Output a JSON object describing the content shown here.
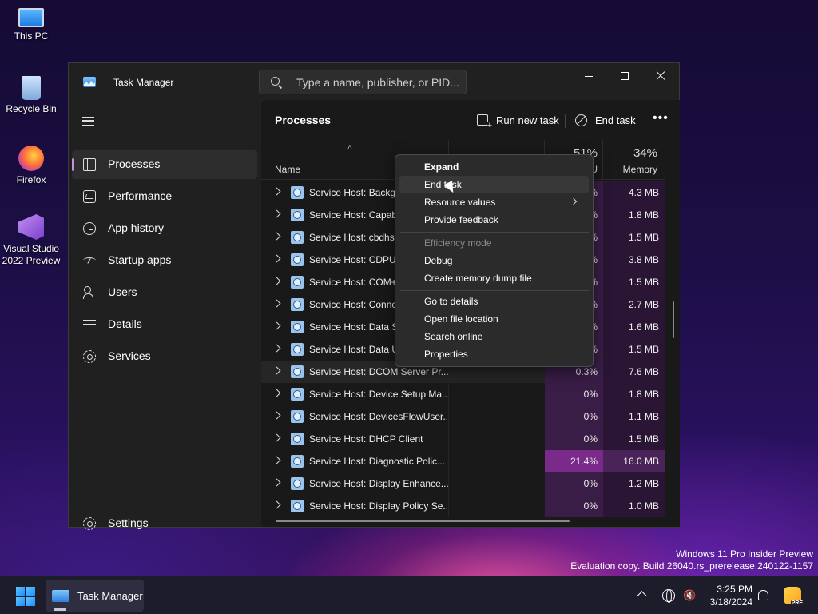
{
  "desktop": {
    "icons": [
      {
        "label": "This PC"
      },
      {
        "label": "Recycle Bin"
      },
      {
        "label": "Firefox"
      },
      {
        "label": "Visual Studio 2022 Preview"
      }
    ],
    "watermark": {
      "line1": "Windows 11 Pro Insider Preview",
      "line2": "Evaluation copy. Build 26040.rs_prerelease.240122-1157"
    }
  },
  "window": {
    "title": "Task Manager",
    "search_placeholder": "Type a name, publisher, or PID..."
  },
  "nav": {
    "items": [
      {
        "label": "Processes",
        "icon": "processes-icon",
        "active": true
      },
      {
        "label": "Performance",
        "icon": "performance-icon"
      },
      {
        "label": "App history",
        "icon": "app-history-icon"
      },
      {
        "label": "Startup apps",
        "icon": "startup-apps-icon"
      },
      {
        "label": "Users",
        "icon": "users-icon"
      },
      {
        "label": "Details",
        "icon": "details-icon"
      },
      {
        "label": "Services",
        "icon": "services-icon"
      }
    ],
    "settings_label": "Settings"
  },
  "toolbar": {
    "page_title": "Processes",
    "run_new_task": "Run new task",
    "end_task": "End task",
    "more": "•••"
  },
  "table": {
    "sort_arrow": "˄",
    "col_name": "Name",
    "cpu_pct": "51%",
    "cpu_label": "U",
    "mem_pct": "34%",
    "mem_label": "Memory",
    "rows": [
      {
        "name": "Service Host: Backgr",
        "cpu": "%",
        "mem": "4.3 MB"
      },
      {
        "name": "Service Host: Capabi",
        "cpu": "%",
        "mem": "1.8 MB"
      },
      {
        "name": "Service Host: cbdhsv",
        "cpu": "%",
        "mem": "1.5 MB"
      },
      {
        "name": "Service Host: CDPUs",
        "cpu": "%",
        "mem": "3.8 MB"
      },
      {
        "name": "Service Host: COM+",
        "cpu": "%",
        "mem": "1.5 MB"
      },
      {
        "name": "Service Host: Conne",
        "cpu": "%",
        "mem": "2.7 MB"
      },
      {
        "name": "Service Host: Data Sh",
        "cpu": "%",
        "mem": "1.6 MB"
      },
      {
        "name": "Service Host: Data Us",
        "cpu": "%",
        "mem": "1.5 MB"
      },
      {
        "name": "Service Host: DCOM Server Pr...",
        "cpu": "0.3%",
        "mem": "7.6 MB"
      },
      {
        "name": "Service Host: Device Setup Ma...",
        "cpu": "0%",
        "mem": "1.8 MB"
      },
      {
        "name": "Service Host: DevicesFlowUser...",
        "cpu": "0%",
        "mem": "1.1 MB"
      },
      {
        "name": "Service Host: DHCP Client",
        "cpu": "0%",
        "mem": "1.5 MB"
      },
      {
        "name": "Service Host: Diagnostic Polic...",
        "cpu": "21.4%",
        "mem": "16.0 MB"
      },
      {
        "name": "Service Host: Display Enhance...",
        "cpu": "0%",
        "mem": "1.2 MB"
      },
      {
        "name": "Service Host: Display Policy Se...",
        "cpu": "0%",
        "mem": "1.0 MB"
      }
    ]
  },
  "context_menu": {
    "items": [
      {
        "label": "Expand"
      },
      {
        "label": "End task"
      },
      {
        "label": "Resource values"
      },
      {
        "label": "Provide feedback"
      },
      {
        "label": "Efficiency mode"
      },
      {
        "label": "Debug"
      },
      {
        "label": "Create memory dump file"
      },
      {
        "label": "Go to details"
      },
      {
        "label": "Open file location"
      },
      {
        "label": "Search online"
      },
      {
        "label": "Properties"
      }
    ]
  },
  "taskbar": {
    "app_label": "Task Manager",
    "time": "3:25 PM",
    "date": "3/18/2024"
  },
  "colors": {
    "accent": "#c98ee8",
    "cpu_heat_high": "#7a2a8a",
    "cpu_heat_low": "#3a1d47"
  }
}
